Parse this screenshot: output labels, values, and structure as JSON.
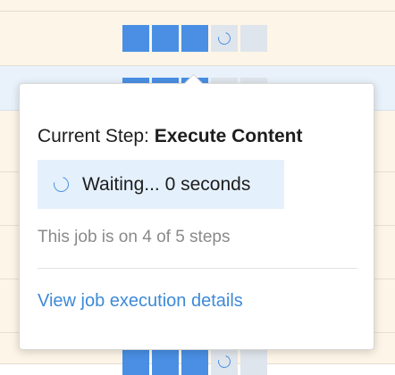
{
  "jobs": [
    {
      "steps": [
        "done",
        "done",
        "done",
        "running",
        "pending"
      ]
    },
    {
      "steps": [
        "done",
        "done",
        "done",
        "running",
        "pending"
      ]
    },
    {
      "steps": [
        "done",
        "done",
        "done",
        "running",
        "pending"
      ]
    }
  ],
  "popover": {
    "current_step_label": "Current Step:",
    "current_step_value": "Execute Content",
    "status_text": "Waiting... 0 seconds",
    "progress_text": "This job is on 4 of 5 steps",
    "link_text": "View job execution details"
  },
  "progress": {
    "current": 4,
    "total": 5
  },
  "colors": {
    "step_done": "#4a8fe4",
    "step_pending": "#dfe5ec",
    "link": "#3d8ad8",
    "status_bg": "#e4f0fb"
  }
}
